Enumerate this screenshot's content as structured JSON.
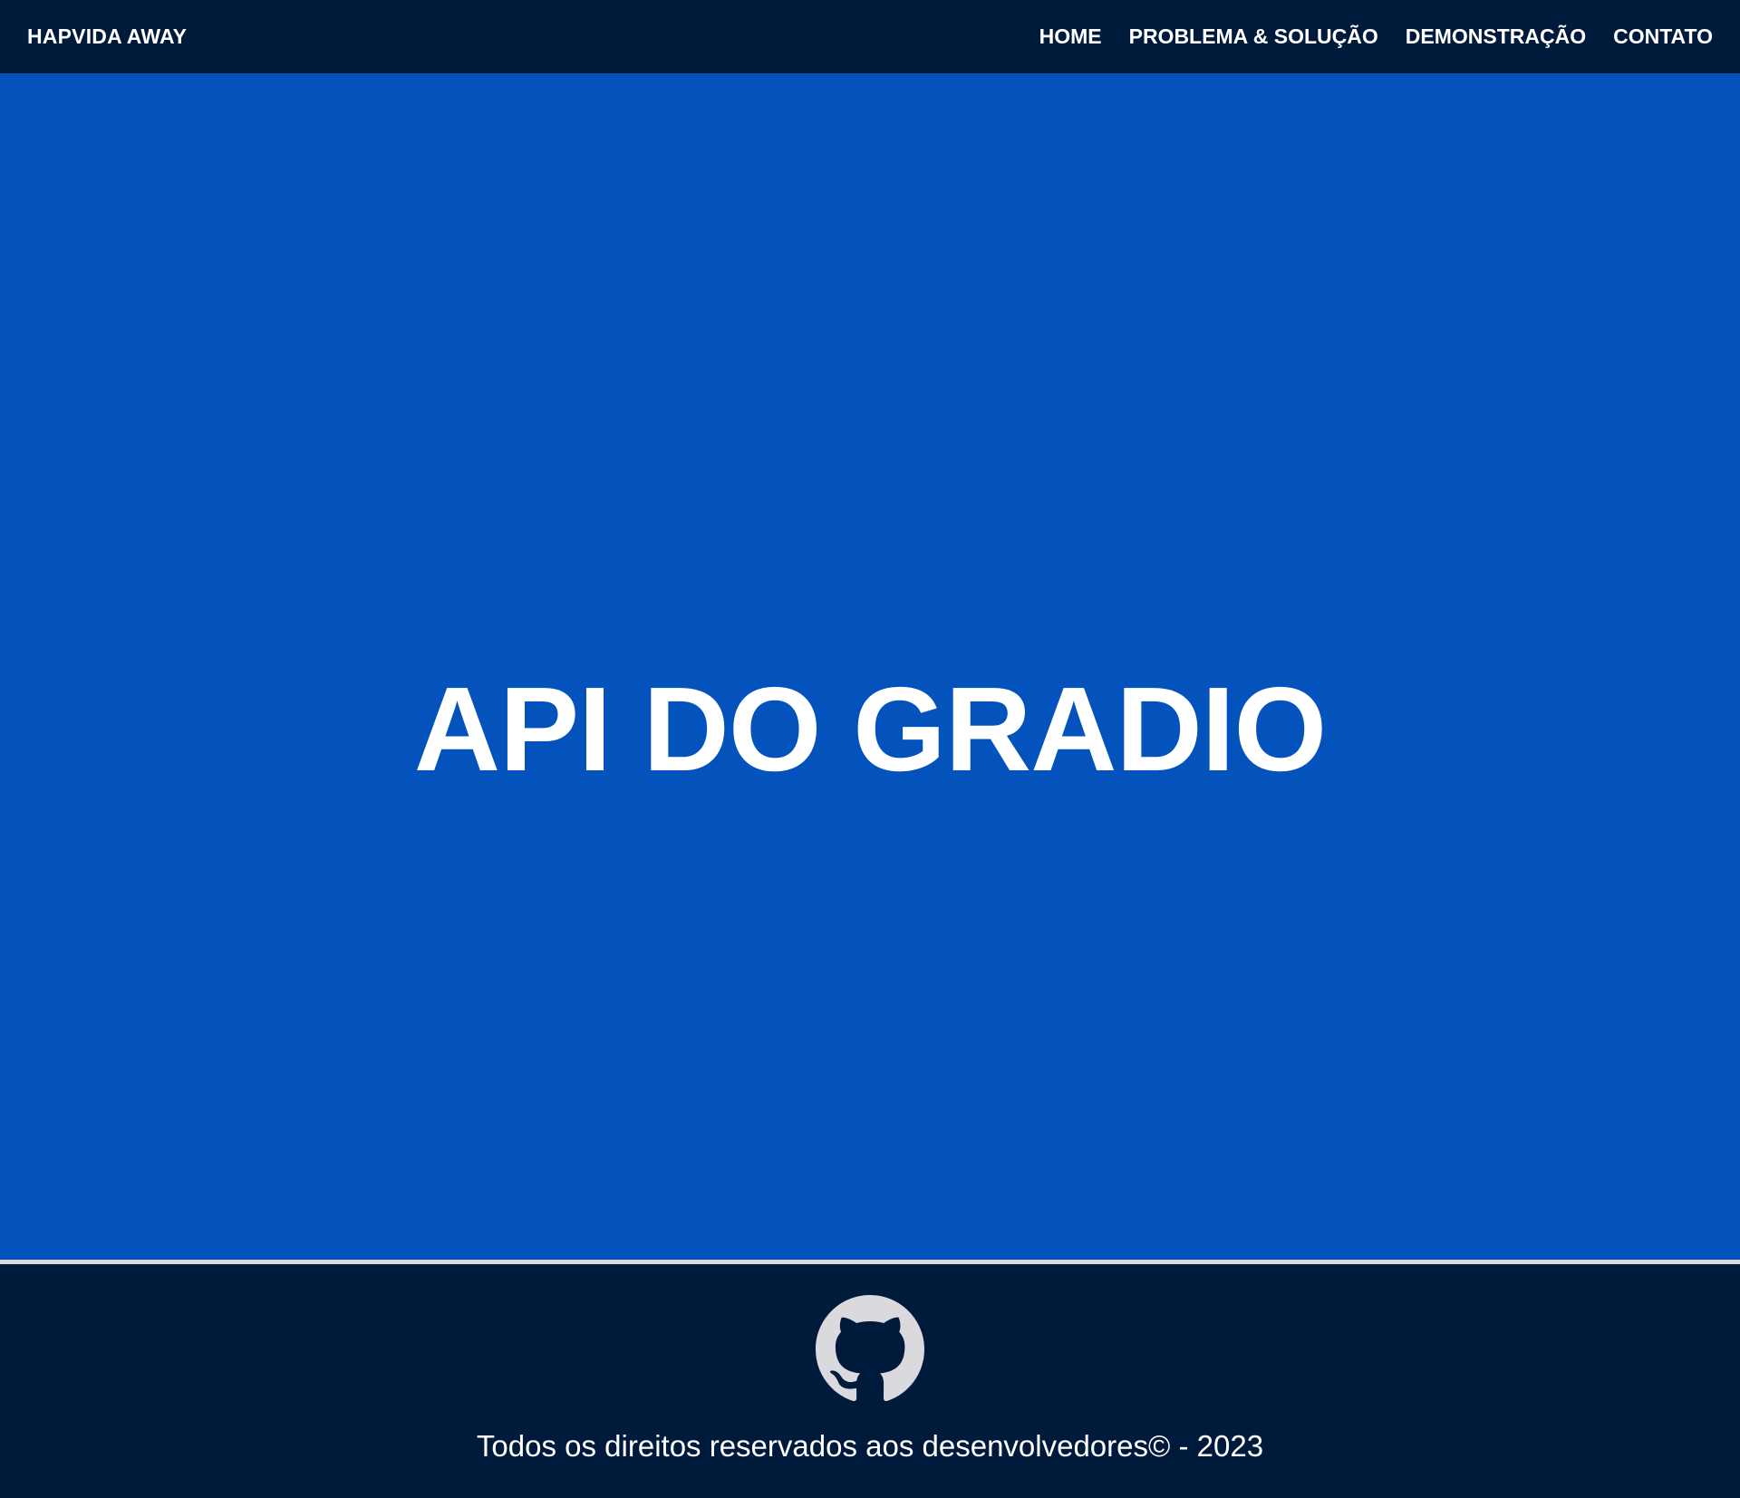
{
  "header": {
    "brand": "HAPVIDA AWAY",
    "nav": [
      {
        "label": "HOME"
      },
      {
        "label": "PROBLEMA & SOLUÇÃO"
      },
      {
        "label": "DEMONSTRAÇÃO"
      },
      {
        "label": "CONTATO"
      }
    ]
  },
  "hero": {
    "title": "API DO GRADIO"
  },
  "footer": {
    "icon": "github-icon",
    "copyright": "Todos os direitos reservados aos desenvolvedores© - 2023"
  },
  "colors": {
    "navbar_bg": "#001A3C",
    "hero_bg": "#0453BC",
    "footer_bg": "#001A3C",
    "divider": "#D9D9DE",
    "text": "#FFFFFF",
    "icon": "#D9D9DE"
  }
}
